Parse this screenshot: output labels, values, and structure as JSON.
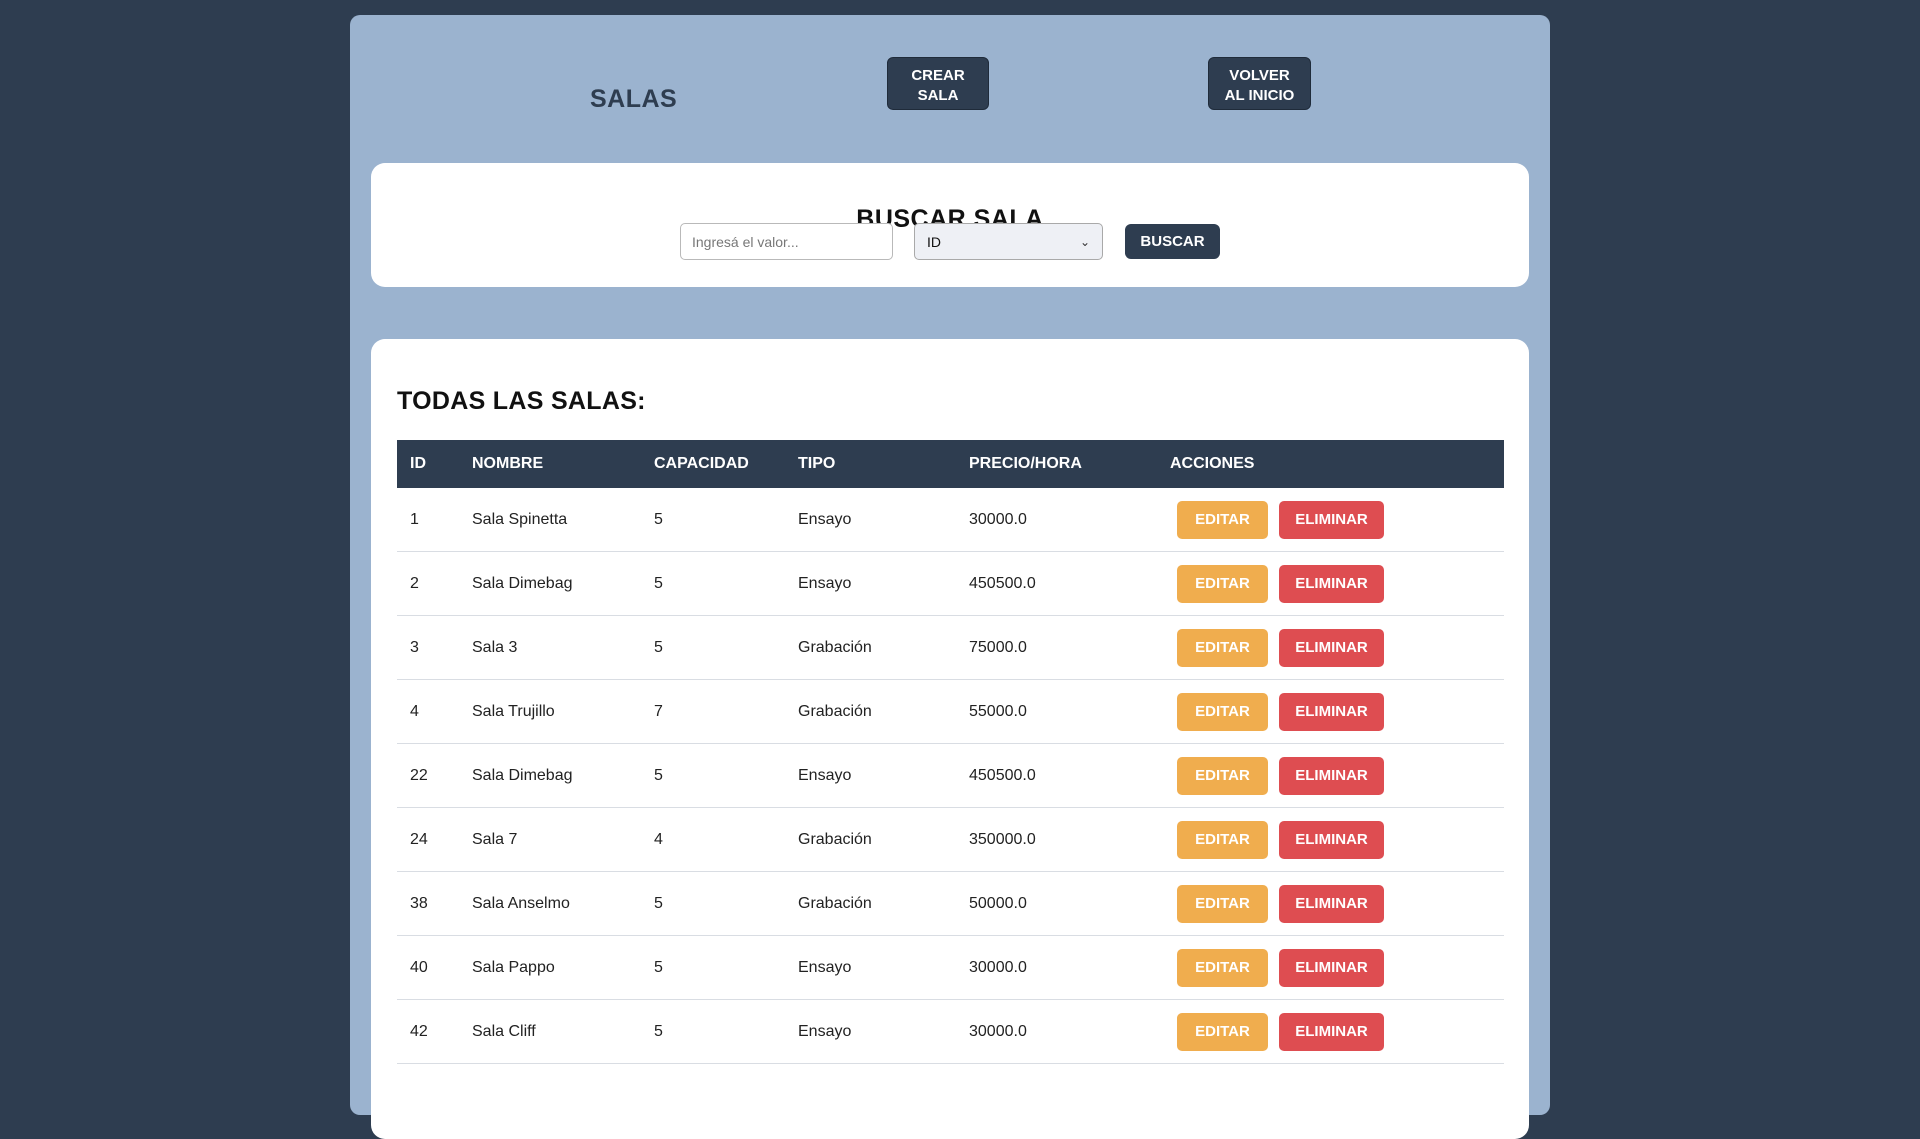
{
  "header": {
    "title": "SALAS",
    "crear_line1": "CREAR",
    "crear_line2": "SALA",
    "volver_line1": "VOLVER",
    "volver_line2": "AL INICIO"
  },
  "search": {
    "title": "BUSCAR SALA",
    "placeholder": "Ingresá el valor...",
    "value": "",
    "select_value": "ID",
    "button_label": "BUSCAR"
  },
  "table": {
    "title": "TODAS LAS SALAS:",
    "columns": [
      "ID",
      "NOMBRE",
      "CAPACIDAD",
      "TIPO",
      "PRECIO/HORA",
      "ACCIONES"
    ],
    "edit_label": "EDITAR",
    "delete_label": "ELIMINAR",
    "rows": [
      {
        "id": "1",
        "nombre": "Sala Spinetta",
        "capacidad": "5",
        "tipo": "Ensayo",
        "precio": "30000.0"
      },
      {
        "id": "2",
        "nombre": "Sala Dimebag",
        "capacidad": "5",
        "tipo": "Ensayo",
        "precio": "450500.0"
      },
      {
        "id": "3",
        "nombre": "Sala 3",
        "capacidad": "5",
        "tipo": "Grabación",
        "precio": "75000.0"
      },
      {
        "id": "4",
        "nombre": "Sala Trujillo",
        "capacidad": "7",
        "tipo": "Grabación",
        "precio": "55000.0"
      },
      {
        "id": "22",
        "nombre": "Sala Dimebag",
        "capacidad": "5",
        "tipo": "Ensayo",
        "precio": "450500.0"
      },
      {
        "id": "24",
        "nombre": "Sala 7",
        "capacidad": "4",
        "tipo": "Grabación",
        "precio": "350000.0"
      },
      {
        "id": "38",
        "nombre": "Sala Anselmo",
        "capacidad": "5",
        "tipo": "Grabación",
        "precio": "50000.0"
      },
      {
        "id": "40",
        "nombre": "Sala Pappo",
        "capacidad": "5",
        "tipo": "Ensayo",
        "precio": "30000.0"
      },
      {
        "id": "42",
        "nombre": "Sala Cliff",
        "capacidad": "5",
        "tipo": "Ensayo",
        "precio": "30000.0"
      }
    ]
  },
  "colors": {
    "page_bg": "#2e3d50",
    "panel_bg": "#9bb3cf",
    "primary": "#2e3d50",
    "edit": "#f0ad4e",
    "delete": "#de4d51"
  }
}
